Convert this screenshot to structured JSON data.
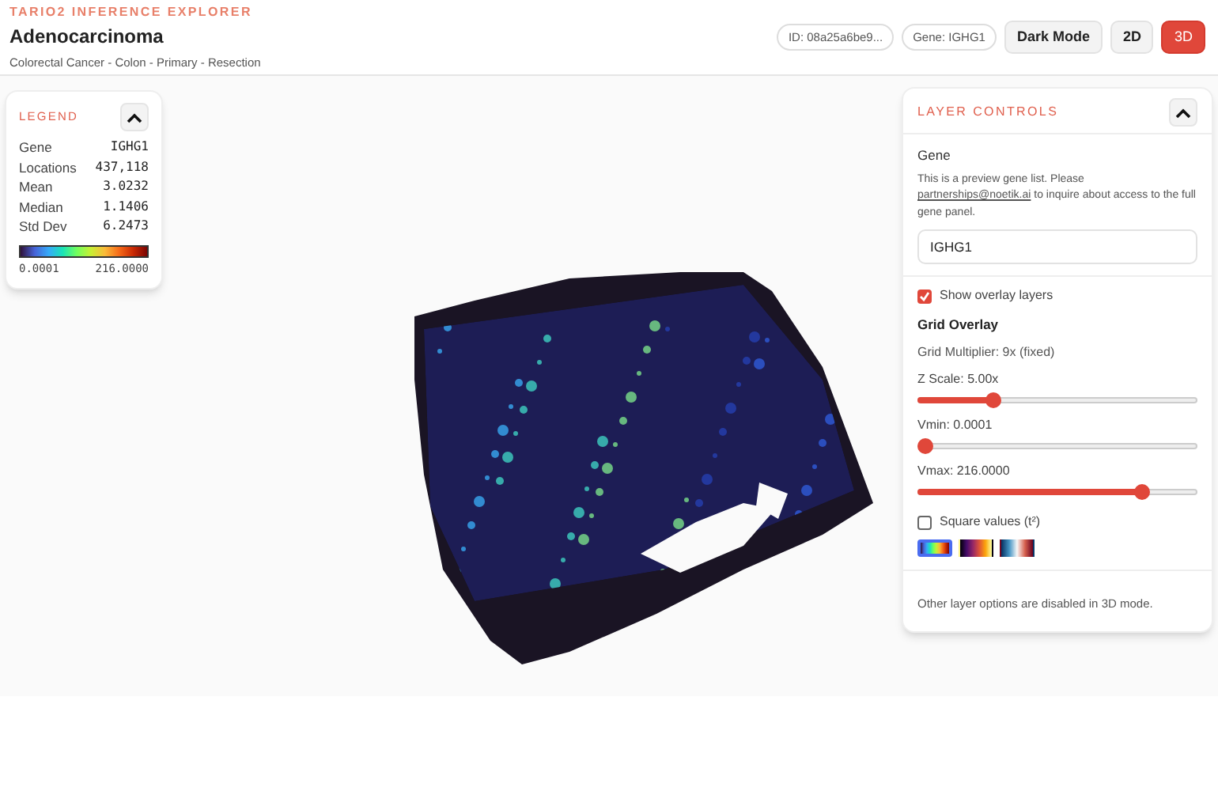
{
  "header": {
    "app_name": "TARIO2 INFERENCE EXPLORER",
    "title": "Adenocarcinoma",
    "subtitle": "Colorectal Cancer - Colon - Primary - Resection",
    "id_chip": "ID: 08a25a6be9...",
    "gene_chip": "Gene: IGHG1",
    "dark_mode_button": "Dark Mode",
    "view_modes": [
      {
        "label": "2D",
        "selected": false
      },
      {
        "label": "3D",
        "selected": true
      }
    ]
  },
  "legend": {
    "title": "LEGEND",
    "expanded": true,
    "stats": [
      {
        "label": "Gene",
        "value": "IGHG1"
      },
      {
        "label": "Locations",
        "value": "437,118"
      },
      {
        "label": "Mean",
        "value": "3.0232"
      },
      {
        "label": "Median",
        "value": "1.1406"
      },
      {
        "label": "Std Dev",
        "value": "6.2473"
      }
    ],
    "scale_min": "0.0001",
    "scale_max": "216.0000"
  },
  "layer_controls": {
    "title": "LAYER CONTROLS",
    "expanded": true,
    "gene_label": "Gene",
    "note_before": "This is a preview gene list. Please ",
    "note_link": "partnerships@noetik.ai",
    "note_after": " to inquire about access to the full gene panel.",
    "gene_value": "IGHG1",
    "show_overlay": {
      "label": "Show overlay layers",
      "checked": true
    },
    "grid_title": "Grid Overlay",
    "grid_multiplier": "Grid Multiplier: 9x (fixed)",
    "sliders": [
      {
        "label": "Z Scale: 5.00x",
        "level": 0.26
      },
      {
        "label": "Vmin: 0.0001",
        "level": 0.0
      },
      {
        "label": "Vmax: 216.0000",
        "level": 0.82
      }
    ],
    "square_values": {
      "label": "Square values (t²)",
      "checked": false
    },
    "colormaps": [
      {
        "kind": "turbo",
        "selected": true
      },
      {
        "kind": "inferno",
        "selected": false
      },
      {
        "kind": "diverging",
        "selected": false
      }
    ],
    "footer": "Other layer options are disabled in 3D mode."
  }
}
